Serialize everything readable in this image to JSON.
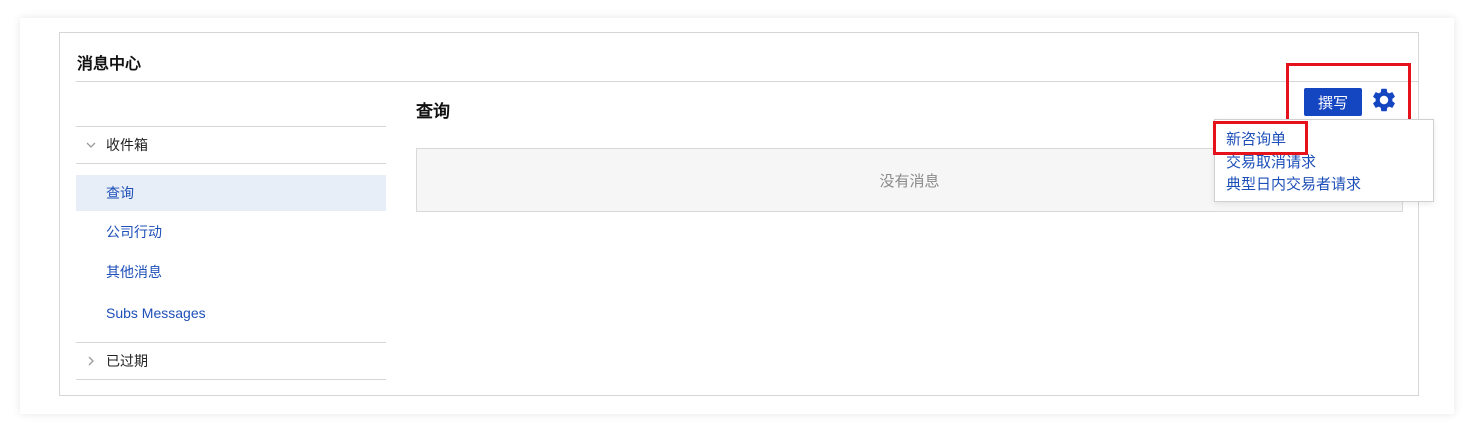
{
  "panel": {
    "title": "消息中心"
  },
  "sidebar": {
    "inbox": {
      "label": "收件箱",
      "expanded": true
    },
    "items": [
      {
        "label": "查询",
        "active": true
      },
      {
        "label": "公司行动",
        "active": false
      },
      {
        "label": "其他消息",
        "active": false
      },
      {
        "label": "Subs Messages",
        "active": false
      }
    ],
    "expired": {
      "label": "已过期",
      "expanded": false
    }
  },
  "content": {
    "title": "查询",
    "empty_text": "没有消息"
  },
  "toolbar": {
    "compose_label": "撰写",
    "settings_icon": "gear-icon"
  },
  "dropdown": {
    "items": [
      {
        "label": "新咨询单",
        "highlighted": true
      },
      {
        "label": "交易取消请求"
      },
      {
        "label": "典型日内交易者请求"
      }
    ]
  },
  "colors": {
    "accent": "#1546c2",
    "link": "#1d4fb8",
    "highlight": "#e5121b",
    "active_bg": "#e8eef8"
  }
}
